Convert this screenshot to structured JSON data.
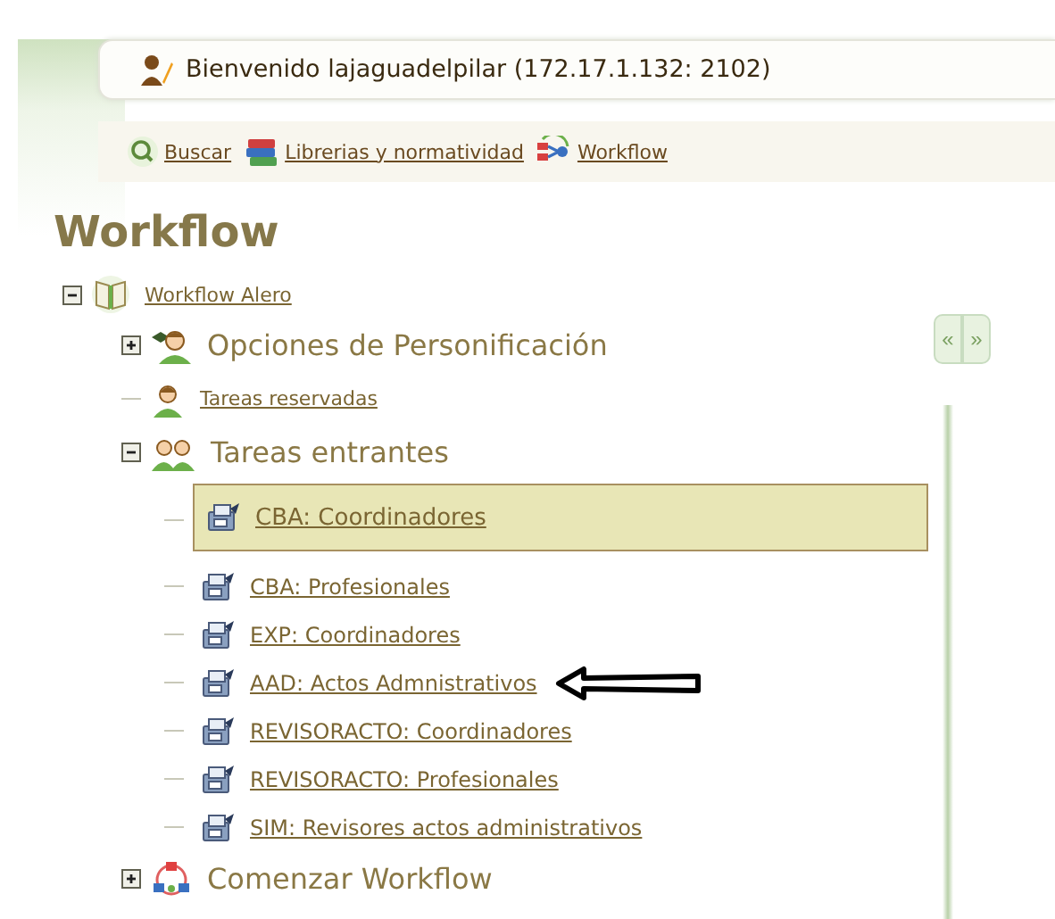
{
  "header": {
    "welcome": "Bienvenido lajaguadelpilar (172.17.1.132: 2102)"
  },
  "nav": [
    "Buscar",
    "Librerias y normatividad",
    "Workflow"
  ],
  "page_title": "Workflow",
  "pager": [
    "«",
    "»"
  ],
  "tree": {
    "label": "Workflow Alero",
    "kind": "root",
    "expanded": true,
    "children": [
      {
        "label": "Opciones de Personificación",
        "kind": "options",
        "expanded": false
      },
      {
        "label": "Tareas reservadas",
        "kind": "reserved"
      },
      {
        "label": "Tareas entrantes",
        "kind": "incoming",
        "expanded": true,
        "children": [
          {
            "label": "CBA: Coordinadores",
            "kind": "queue",
            "selected": true,
            "pointer_arrow": false
          },
          {
            "label": "CBA: Profesionales",
            "kind": "queue",
            "selected": false,
            "pointer_arrow": false
          },
          {
            "label": "EXP: Coordinadores",
            "kind": "queue",
            "selected": false,
            "pointer_arrow": false
          },
          {
            "label": "AAD: Actos Admnistrativos",
            "kind": "queue",
            "selected": false,
            "pointer_arrow": true
          },
          {
            "label": "REVISORACTO: Coordinadores",
            "kind": "queue",
            "selected": false,
            "pointer_arrow": false
          },
          {
            "label": "REVISORACTO: Profesionales",
            "kind": "queue",
            "selected": false,
            "pointer_arrow": false
          },
          {
            "label": "SIM: Revisores actos administrativos",
            "kind": "queue",
            "selected": false,
            "pointer_arrow": false
          }
        ]
      },
      {
        "label": "Comenzar Workflow",
        "kind": "start",
        "expanded": false
      }
    ]
  }
}
